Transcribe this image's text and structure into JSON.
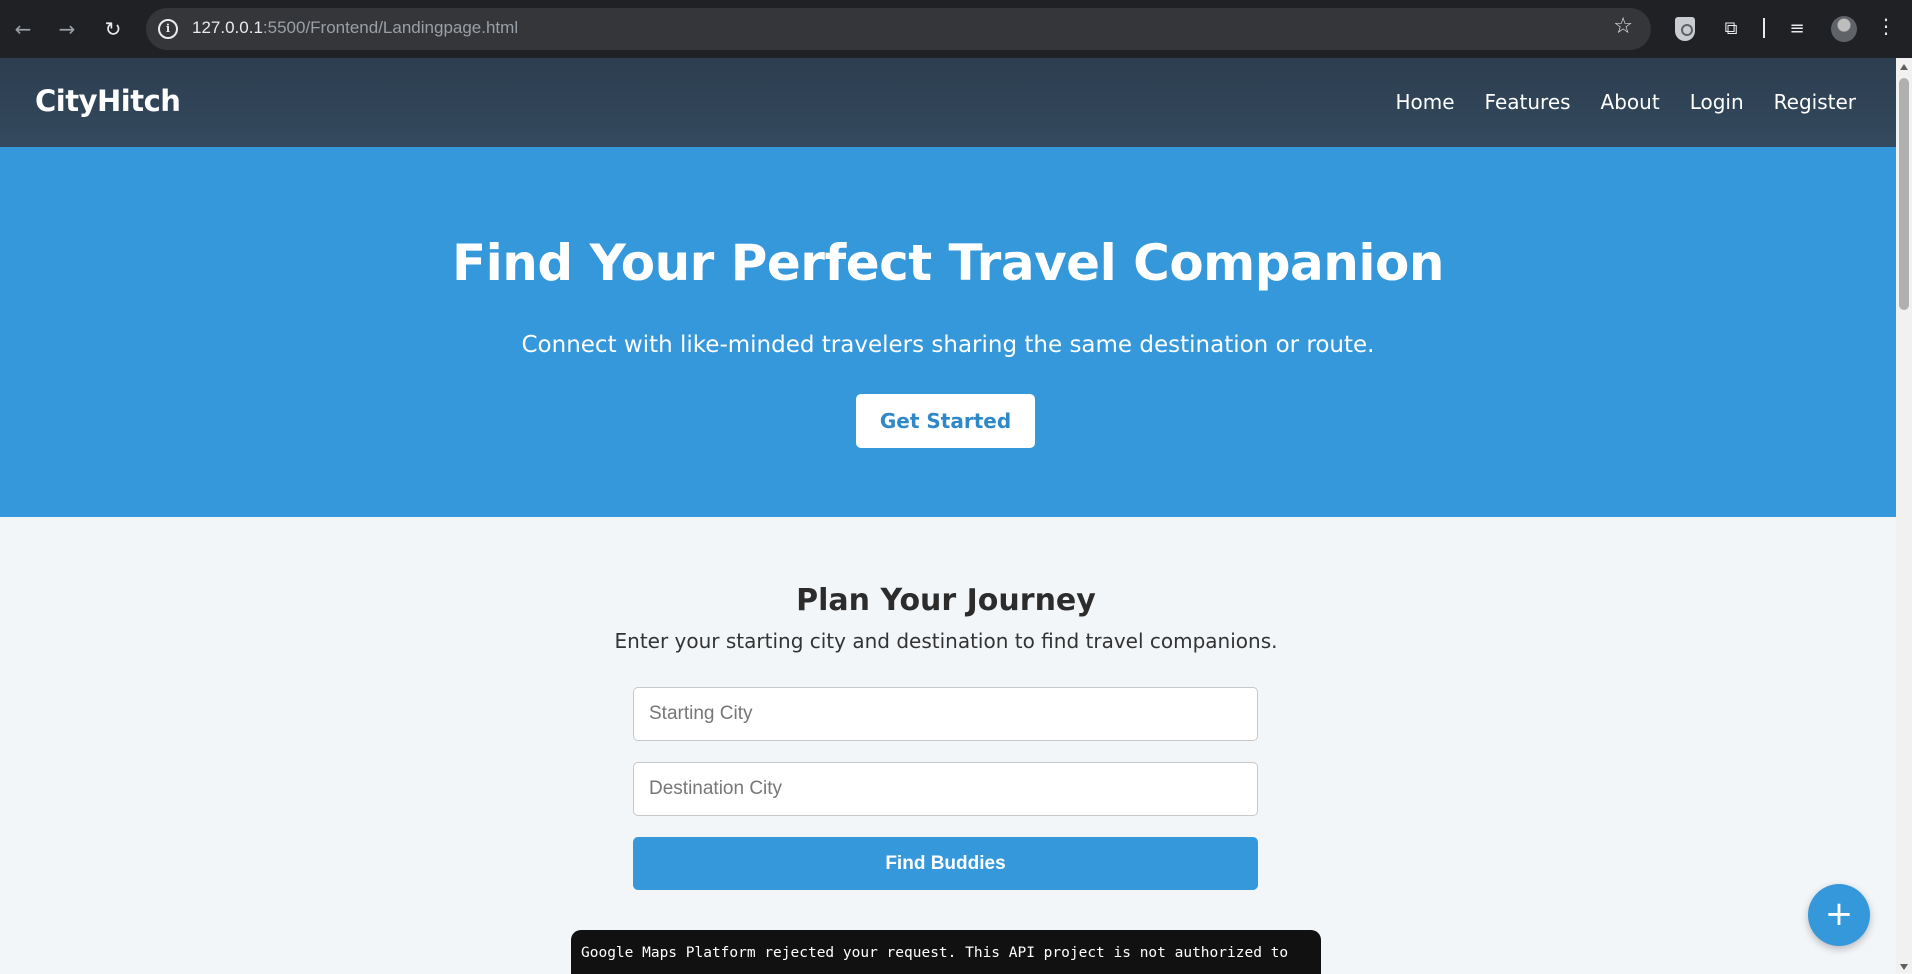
{
  "browser": {
    "url_host": "127.0.0.1",
    "url_rest": ":5500/Frontend/Landingpage.html",
    "icons": [
      "back-arrow-icon",
      "forward-arrow-icon",
      "reload-icon",
      "site-info-icon",
      "star-icon",
      "shield-extension-icon",
      "puzzle-extensions-icon",
      "media-control-icon",
      "profile-avatar",
      "more-menu-icon"
    ]
  },
  "header": {
    "logo": "CityHitch",
    "nav": [
      "Home",
      "Features",
      "About",
      "Login",
      "Register"
    ]
  },
  "hero": {
    "title": "Find Your Perfect Travel Companion",
    "subtitle": "Connect with like-minded travelers sharing the same destination or route.",
    "cta_label": "Get Started"
  },
  "journey": {
    "title": "Plan Your Journey",
    "subtitle": "Enter your starting city and destination to find travel companions.",
    "start_placeholder": "Starting City",
    "destination_placeholder": "Destination City",
    "button_label": "Find Buddies"
  },
  "toast": {
    "message": "Google Maps Platform rejected your request. This API project is not authorized to"
  },
  "fab": {
    "label": "+"
  },
  "colors": {
    "header_bg": "#2c3e50",
    "accent": "#3498db",
    "page_bg": "#f3f6f9"
  }
}
